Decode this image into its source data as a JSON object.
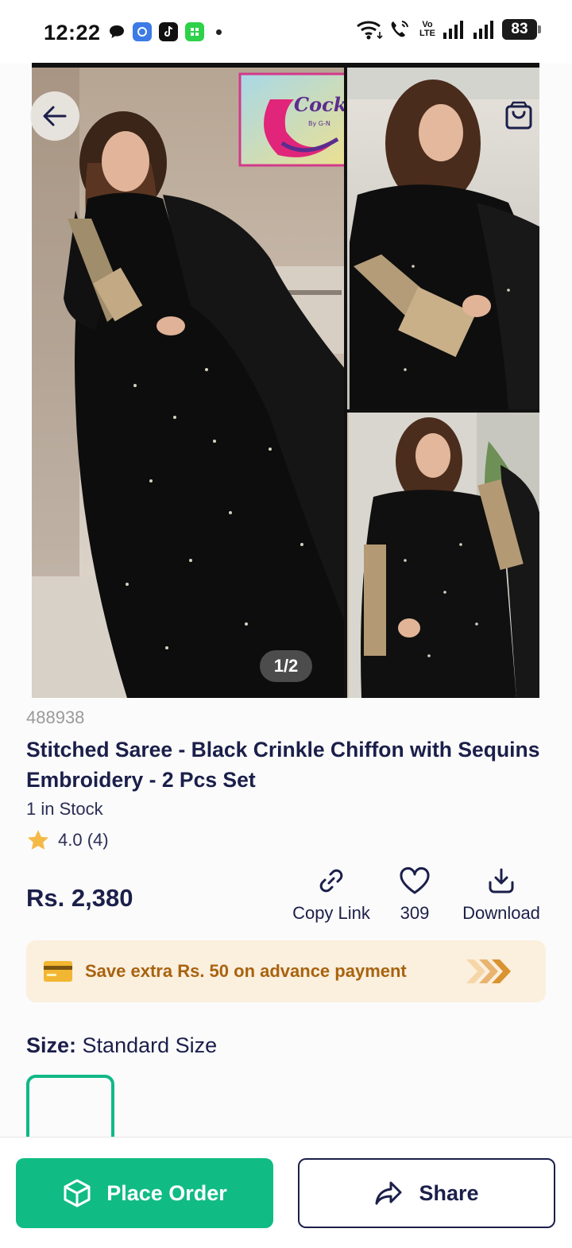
{
  "status_bar": {
    "time": "12:22",
    "battery": "83",
    "network_label": "Vo\nLTE"
  },
  "gallery": {
    "brand_logo_text": "Cocktail",
    "brand_logo_sub": "By G-N",
    "pager": "1/2"
  },
  "product": {
    "sku": "488938",
    "title": "Stitched Saree - Black Crinkle Chiffon with Sequins Embroidery - 2 Pcs Set",
    "stock": "1 in Stock",
    "rating": "4.0 (4)",
    "price": "Rs. 2,380"
  },
  "actions": {
    "copy_link": "Copy Link",
    "likes": "309",
    "download": "Download"
  },
  "promo": {
    "text": "Save extra Rs. 50 on advance payment"
  },
  "size": {
    "label": "Size:",
    "value": "Standard Size"
  },
  "bottom": {
    "place_order": "Place Order",
    "share": "Share"
  },
  "colors": {
    "primary_green": "#10bb84",
    "navy": "#1b1f4a",
    "promo_bg": "#fbefde",
    "promo_text": "#a8630f",
    "star": "#f5b945"
  },
  "icons": [
    "back-arrow-icon",
    "shopping-bag-icon",
    "link-icon",
    "heart-icon",
    "download-icon",
    "card-icon",
    "double-chevron-icon",
    "star-icon",
    "box-icon",
    "share-icon"
  ]
}
